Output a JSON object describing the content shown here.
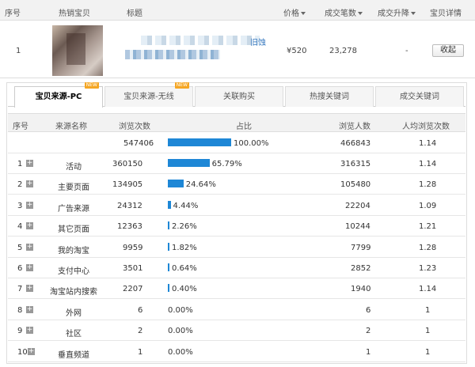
{
  "product_table": {
    "headers": {
      "index": "序号",
      "hot_item": "热销宝贝",
      "title": "标题",
      "price": "价格",
      "sold": "成交笔数",
      "trend": "成交升降",
      "detail": "宝贝详情"
    },
    "row": {
      "index": "1",
      "title_link": "旧蚀",
      "price": "¥520",
      "sold": "23,278",
      "trend": "-",
      "action": "收起"
    }
  },
  "tabs": [
    {
      "label": "宝贝来源-PC",
      "badge": "NEW",
      "active": true
    },
    {
      "label": "宝贝来源-无线",
      "badge": "NEW",
      "active": false
    },
    {
      "label": "关联购买",
      "badge": "",
      "active": false
    },
    {
      "label": "热搜关键词",
      "badge": "",
      "active": false
    },
    {
      "label": "成交关键词",
      "badge": "",
      "active": false
    }
  ],
  "source_table": {
    "headers": {
      "index": "序号",
      "source": "来源名称",
      "views": "浏览次数",
      "share": "占比",
      "visitors": "浏览人数",
      "per_person": "人均浏览次数"
    },
    "total": {
      "views": "547406",
      "share": "100.00%",
      "share_value": 100.0,
      "visitors": "466843",
      "per_person": "1.14"
    },
    "rows": [
      {
        "index": "1",
        "source": "活动",
        "views": "360150",
        "share": "65.79%",
        "share_value": 65.79,
        "visitors": "316315",
        "per_person": "1.14"
      },
      {
        "index": "2",
        "source": "主要页面",
        "views": "134905",
        "share": "24.64%",
        "share_value": 24.64,
        "visitors": "105480",
        "per_person": "1.28"
      },
      {
        "index": "3",
        "source": "广告来源",
        "views": "24312",
        "share": "4.44%",
        "share_value": 4.44,
        "visitors": "22204",
        "per_person": "1.09"
      },
      {
        "index": "4",
        "source": "其它页面",
        "views": "12363",
        "share": "2.26%",
        "share_value": 2.26,
        "visitors": "10244",
        "per_person": "1.21"
      },
      {
        "index": "5",
        "source": "我的淘宝",
        "views": "9959",
        "share": "1.82%",
        "share_value": 1.82,
        "visitors": "7799",
        "per_person": "1.28"
      },
      {
        "index": "6",
        "source": "支付中心",
        "views": "3501",
        "share": "0.64%",
        "share_value": 0.64,
        "visitors": "2852",
        "per_person": "1.23"
      },
      {
        "index": "7",
        "source": "淘宝站内搜索",
        "views": "2207",
        "share": "0.40%",
        "share_value": 0.4,
        "visitors": "1940",
        "per_person": "1.14"
      },
      {
        "index": "8",
        "source": "外网",
        "views": "6",
        "share": "0.00%",
        "share_value": 0.0,
        "visitors": "6",
        "per_person": "1"
      },
      {
        "index": "9",
        "source": "社区",
        "views": "2",
        "share": "0.00%",
        "share_value": 0.0,
        "visitors": "2",
        "per_person": "1"
      },
      {
        "index": "10",
        "source": "垂直频道",
        "views": "1",
        "share": "0.00%",
        "share_value": 0.0,
        "visitors": "1",
        "per_person": "1"
      }
    ]
  },
  "colors": {
    "bar": "#1e87d6",
    "badge": "#f5a623"
  },
  "icons": {
    "expand": "plus-square-icon",
    "sort": "sort-down-icon"
  }
}
